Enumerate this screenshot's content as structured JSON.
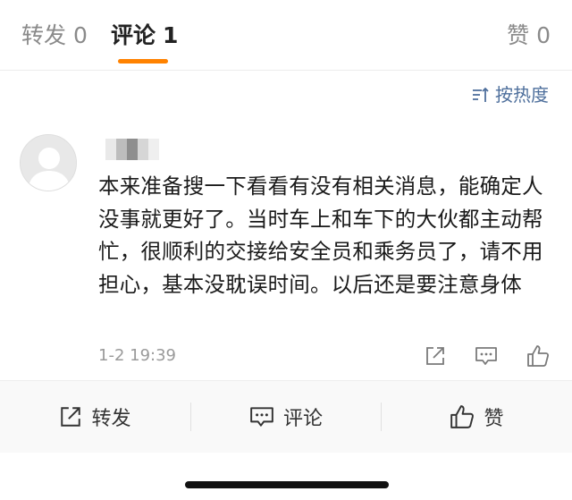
{
  "tabs": [
    {
      "label": "转发",
      "count": "0"
    },
    {
      "label": "评论",
      "count": "1"
    },
    {
      "label": "赞",
      "count": "0"
    }
  ],
  "sort_label": "按热度",
  "comment": {
    "text": "本来准备搜一下看看有没有相关消息，能确定人没事就更好了。当时车上和车下的大伙都主动帮忙，很顺利的交接给安全员和乘务员了，请不用担心，基本没耽误时间。以后还是要注意身体",
    "timestamp": "1-2 19:39"
  },
  "bottom_bar": {
    "forward_label": "转发",
    "comment_label": "评论",
    "like_label": "赞"
  },
  "colors": {
    "accent": "#ff8200",
    "sort_link": "#4e6f9c"
  },
  "icons": [
    "sort-icon",
    "avatar-placeholder",
    "share-icon",
    "comment-icon",
    "like-icon"
  ]
}
